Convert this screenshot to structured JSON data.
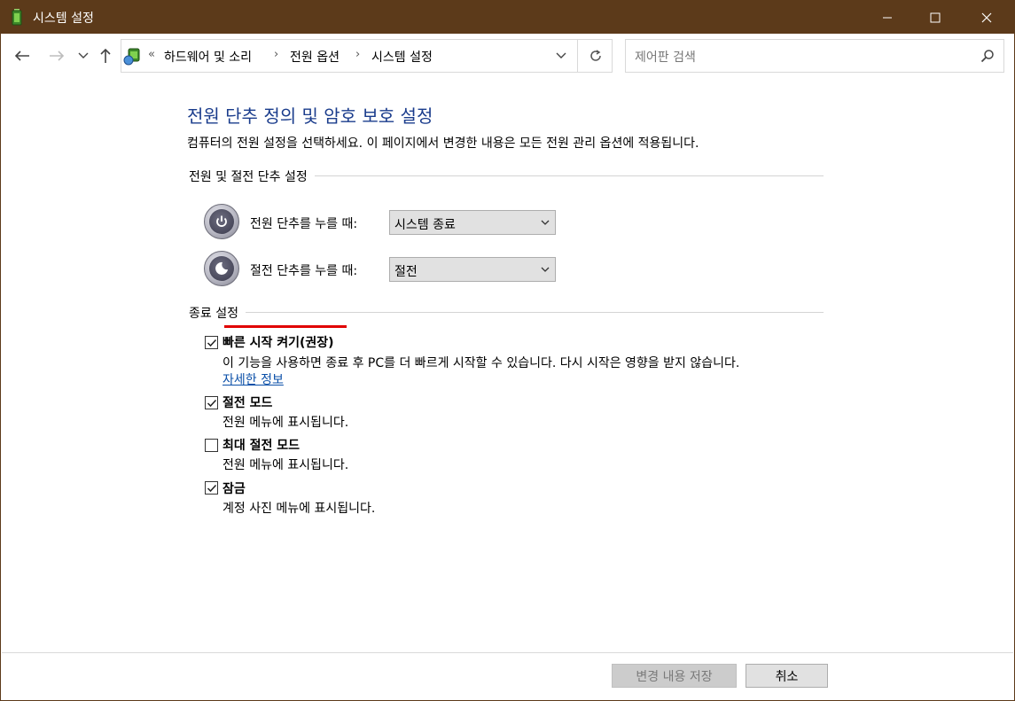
{
  "window": {
    "title": "시스템 설정",
    "title_bar_color": "#5c3a1a"
  },
  "address": {
    "crumbs": [
      "하드웨어 및 소리",
      "전원 옵션",
      "시스템 설정"
    ],
    "overflow": "«"
  },
  "search": {
    "placeholder": "제어판 검색"
  },
  "page": {
    "title": "전원 단추 정의 및 암호 보호 설정",
    "description": "컴퓨터의 전원 설정을 선택하세요. 이 페이지에서 변경한 내용은 모든 전원 관리 옵션에 적용됩니다."
  },
  "power_group": {
    "title": "전원 및 절전 단추 설정",
    "rows": [
      {
        "label": "전원 단추를 누를 때:",
        "value": "시스템 종료",
        "icon": "power-button-icon"
      },
      {
        "label": "절전 단추를 누를 때:",
        "value": "절전",
        "icon": "sleep-button-icon"
      }
    ]
  },
  "shutdown_group": {
    "title": "종료 설정",
    "options": [
      {
        "title": "빠른 시작 켜기(권장)",
        "desc": "이 기능을 사용하면 종료 후 PC를 더 빠르게 시작할 수 있습니다. 다시 시작은 영향을 받지 않습니다.",
        "link": "자세한 정보",
        "checked": true
      },
      {
        "title": "절전 모드",
        "desc": "전원 메뉴에 표시됩니다.",
        "checked": true
      },
      {
        "title": "최대 절전 모드",
        "desc": "전원 메뉴에 표시됩니다.",
        "checked": false
      },
      {
        "title": "잠금",
        "desc": "계정 사진 메뉴에 표시됩니다.",
        "checked": true
      }
    ]
  },
  "footer": {
    "save_label": "변경 내용 저장",
    "cancel_label": "취소"
  }
}
